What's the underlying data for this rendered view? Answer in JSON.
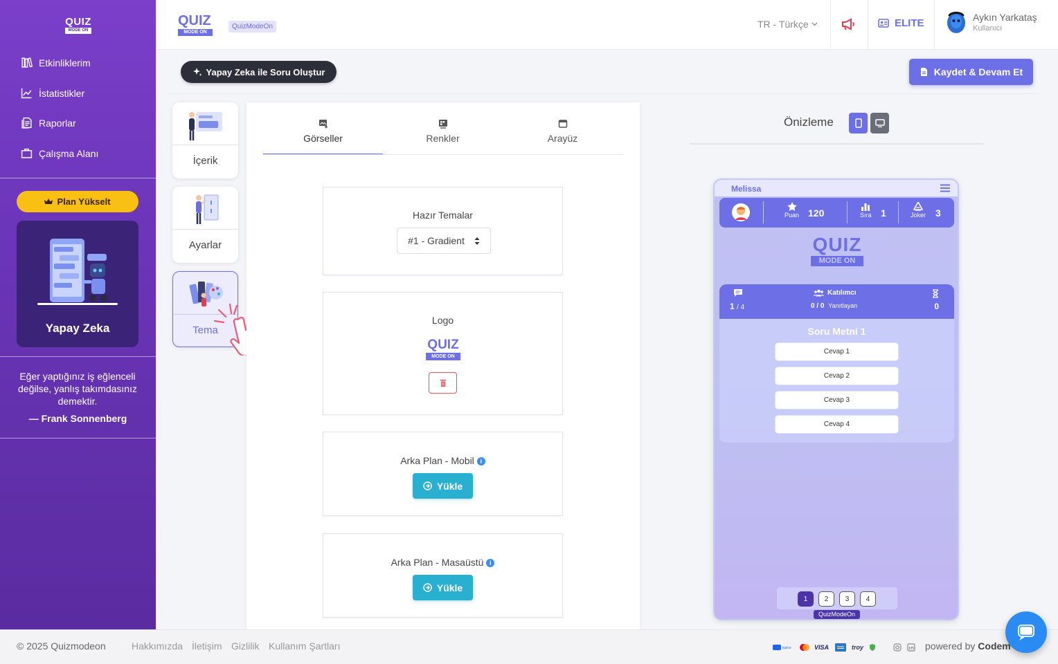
{
  "sidebar": {
    "logo": {
      "quiz": "QUIZ",
      "mode_on": "MODE ON"
    },
    "nav": [
      {
        "label": "Etkinliklerim",
        "icon": "books-icon"
      },
      {
        "label": "İstatistikler",
        "icon": "chart-line-icon"
      },
      {
        "label": "Raporlar",
        "icon": "report-icon"
      },
      {
        "label": "Çalışma Alanı",
        "icon": "briefcase-icon"
      }
    ],
    "upgrade_label": "Plan Yükselt",
    "ai_card_title": "Yapay Zeka",
    "quote": "Eğer yaptığınız iş eğlenceli değilse, yanlış takımdasınız demektir.",
    "quote_author": "— Frank Sonnenberg"
  },
  "topbar": {
    "logo": {
      "quiz": "QUIZ",
      "mode_on": "MODE ON"
    },
    "badge": "QuizModeOn",
    "language": "TR - Türkçe",
    "plan": "ELITE",
    "user_name": "Aykın Yarkataş",
    "user_role": "Kullanıcı"
  },
  "actions": {
    "ai_button": "Yapay Zeka ile Soru Oluştur",
    "save_button": "Kaydet & Devam Et"
  },
  "left_tabs": [
    {
      "label": "İçerik",
      "active": false
    },
    {
      "label": "Ayarlar",
      "active": false
    },
    {
      "label": "Tema",
      "active": true
    }
  ],
  "editor": {
    "tabs": [
      {
        "label": "Görseller",
        "icon": "image-add-icon",
        "active": true
      },
      {
        "label": "Renkler",
        "icon": "palette-icon",
        "active": false
      },
      {
        "label": "Arayüz",
        "icon": "window-icon",
        "active": false
      }
    ],
    "themes": {
      "title": "Hazır Temalar",
      "selected": "#1 - Gradient"
    },
    "logo": {
      "title": "Logo",
      "quiz": "QUIZ",
      "mode_on": "MODE ON"
    },
    "bg_mobile": {
      "title": "Arka Plan - Mobil",
      "button": "Yükle"
    },
    "bg_desktop": {
      "title": "Arka Plan - Masaüstü",
      "button": "Yükle"
    }
  },
  "preview": {
    "title": "Önizleme",
    "player_name": "Melissa",
    "stats": [
      {
        "label": "Puan",
        "value": "120"
      },
      {
        "label": "Sıra",
        "value": "1"
      },
      {
        "label": "Joker",
        "value": "3"
      }
    ],
    "logo": {
      "quiz": "QUIZ",
      "mode_on": "MODE ON"
    },
    "question_progress_current": "1",
    "question_progress_total": "/ 4",
    "participants_label": "Katılımcı",
    "answered_count": "0 / 0",
    "answered_label": "Yanıtlayan",
    "timer_value": "0",
    "question_text": "Soru Metni 1",
    "answers": [
      "Cevap 1",
      "Cevap 2",
      "Cevap 3",
      "Cevap 4"
    ],
    "pages": [
      "1",
      "2",
      "3",
      "4"
    ],
    "active_page": "1",
    "brand": "QuizModeOn"
  },
  "footer": {
    "copyright": "© 2025 Quizmodeon",
    "links": [
      "Hakkımızda",
      "İletişim",
      "Gizlilik",
      "Kullanım Şartları"
    ],
    "payments": [
      "iyzico",
      "mastercard",
      "VISA",
      "amex",
      "troy"
    ],
    "powered_prefix": "powered by",
    "powered_brand": "Codem"
  },
  "colors": {
    "primary": "#6c6fe6",
    "sidebar": "#6a35b8",
    "upgrade": "#f8c012",
    "upload": "#29b0d1",
    "danger": "#e3545d"
  }
}
